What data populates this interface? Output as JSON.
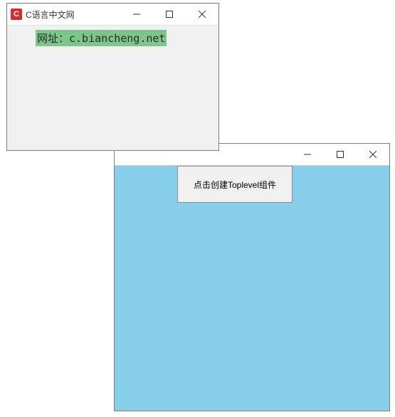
{
  "main_window": {
    "title": "",
    "button_label": "点击创建Toplevel组件",
    "client_bg": "#87ceeb"
  },
  "toplevel_window": {
    "title": "C语言中文网",
    "app_icon_letter": "C",
    "url_label": "网址：c.biancheng.net",
    "label_bg": "#7cc68c",
    "client_bg": "#f0f0f0"
  },
  "icons": {
    "minimize": "minimize-icon",
    "maximize": "maximize-icon",
    "close": "close-icon"
  }
}
